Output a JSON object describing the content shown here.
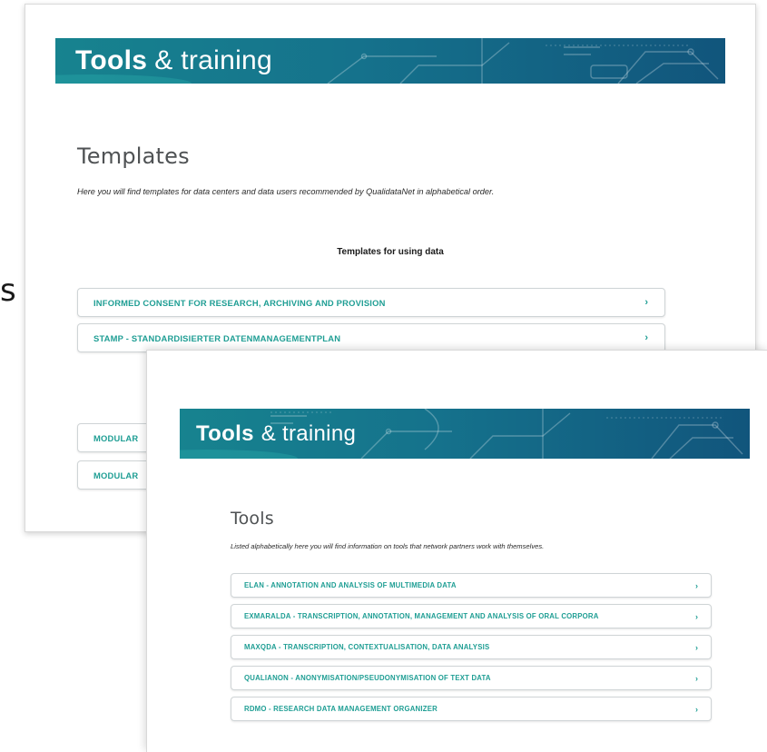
{
  "edge_glyph": "s",
  "back_page": {
    "banner": {
      "strong": "Tools",
      "rest": "& training"
    },
    "heading": "Templates",
    "intro": "Here you will find templates for data centers and data users recommended by QualidataNet in alphabetical order.",
    "section_heading": "Templates for using data",
    "items": [
      {
        "label": "INFORMED CONSENT FOR RESEARCH, ARCHIVING AND PROVISION"
      },
      {
        "label": "STAMP - STANDARDISIERTER DATENMANAGEMENTPLAN"
      }
    ],
    "hidden_items": [
      {
        "label": "MODULAR"
      },
      {
        "label": "MODULAR"
      }
    ]
  },
  "front_page": {
    "banner": {
      "strong": "Tools",
      "rest": "& training"
    },
    "heading": "Tools",
    "intro": "Listed alphabetically here you will find information on tools that network partners work with themselves.",
    "items": [
      {
        "label": "ELAN - ANNOTATION AND ANALYSIS OF MULTIMEDIA DATA"
      },
      {
        "label": "EXMARALDA - TRANSCRIPTION, ANNOTATION, MANAGEMENT AND ANALYSIS OF ORAL CORPORA"
      },
      {
        "label": "MAXQDA - TRANSCRIPTION, CONTEXTUALISATION, DATA ANALYSIS"
      },
      {
        "label": "QUALIANON - ANONYMISATION/PSEUDONYMISATION OF TEXT DATA"
      },
      {
        "label": "RDMO - RESEARCH DATA MANAGEMENT ORGANIZER"
      }
    ]
  },
  "icons": {
    "expand": "chevron-right-icon"
  },
  "chevron_glyph": "›",
  "colors": {
    "accent_teal": "#1f9e94",
    "banner_start": "#17838f",
    "banner_end": "#11557c",
    "heading_gray": "#4f5254"
  }
}
